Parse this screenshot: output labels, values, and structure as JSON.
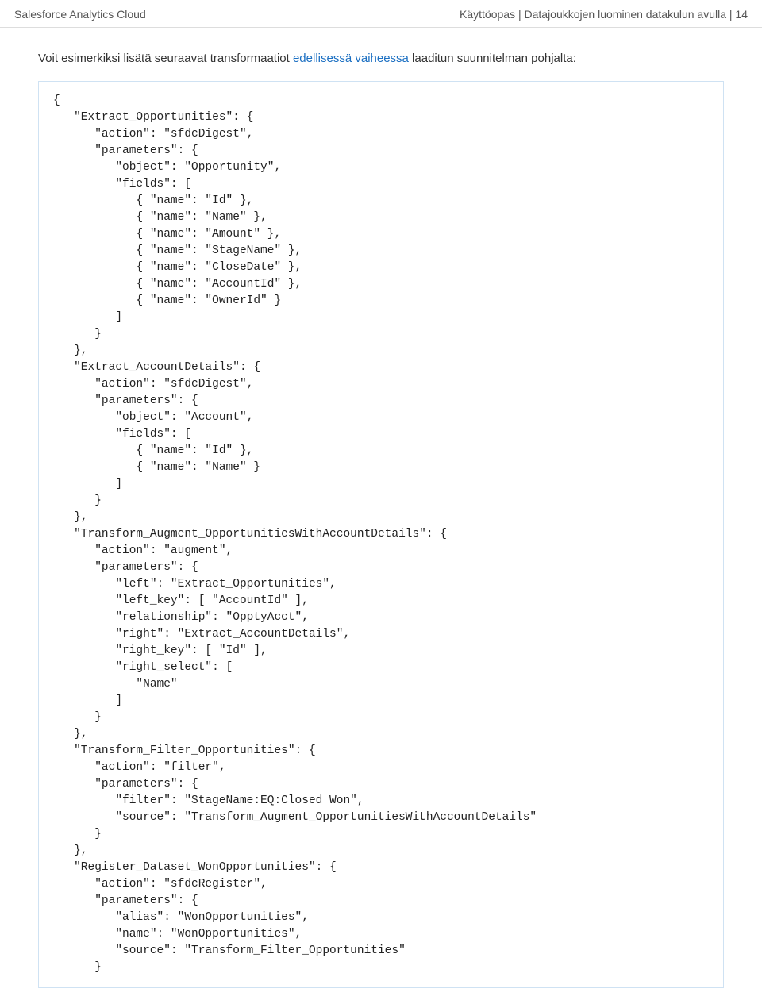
{
  "header": {
    "left": "Salesforce Analytics Cloud",
    "right": "Käyttöopas | Datajoukkojen luominen datakulun avulla | 14"
  },
  "intro": {
    "prefix": "Voit esimerkiksi lisätä seuraavat transformaatiot ",
    "link": "edellisessä vaiheessa",
    "suffix": " laaditun suunnitelman pohjalta:"
  },
  "code": "{\n   \"Extract_Opportunities\": {\n      \"action\": \"sfdcDigest\",\n      \"parameters\": {\n         \"object\": \"Opportunity\",\n         \"fields\": [\n            { \"name\": \"Id\" },\n            { \"name\": \"Name\" },\n            { \"name\": \"Amount\" },\n            { \"name\": \"StageName\" },\n            { \"name\": \"CloseDate\" },\n            { \"name\": \"AccountId\" },\n            { \"name\": \"OwnerId\" }\n         ]\n      }\n   },\n   \"Extract_AccountDetails\": {\n      \"action\": \"sfdcDigest\",\n      \"parameters\": {\n         \"object\": \"Account\",\n         \"fields\": [\n            { \"name\": \"Id\" },\n            { \"name\": \"Name\" }\n         ]\n      }\n   },\n   \"Transform_Augment_OpportunitiesWithAccountDetails\": {\n      \"action\": \"augment\",\n      \"parameters\": {\n         \"left\": \"Extract_Opportunities\",\n         \"left_key\": [ \"AccountId\" ],\n         \"relationship\": \"OpptyAcct\",\n         \"right\": \"Extract_AccountDetails\",\n         \"right_key\": [ \"Id\" ],\n         \"right_select\": [\n            \"Name\"\n         ]\n      }\n   },\n   \"Transform_Filter_Opportunities\": {\n      \"action\": \"filter\",\n      \"parameters\": {\n         \"filter\": \"StageName:EQ:Closed Won\",\n         \"source\": \"Transform_Augment_OpportunitiesWithAccountDetails\"\n      }\n   },\n   \"Register_Dataset_WonOpportunities\": {\n      \"action\": \"sfdcRegister\",\n      \"parameters\": {\n         \"alias\": \"WonOpportunities\",\n         \"name\": \"WonOpportunities\",\n         \"source\": \"Transform_Filter_Opportunities\"\n      }"
}
